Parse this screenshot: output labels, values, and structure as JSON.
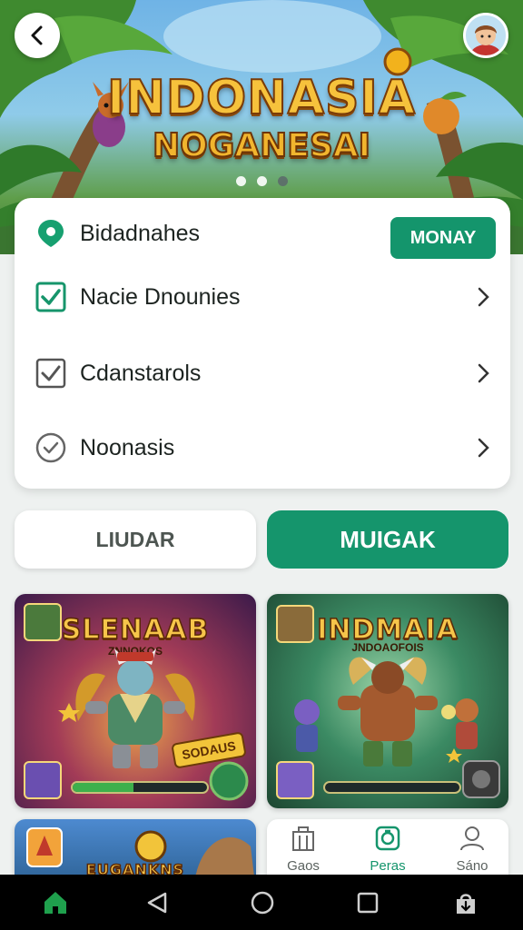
{
  "banner": {
    "title_line1": "INDONASIA",
    "title_line2": "NOGANESAI",
    "carousel_pages": 3,
    "carousel_active": 2
  },
  "settings": {
    "items": [
      {
        "label": "Bidadnahes",
        "icon": "location-pin-icon",
        "action_label": "MONAY"
      },
      {
        "label": "Nacie Dnounies",
        "icon": "checkbox-checked-icon"
      },
      {
        "label": "Cdanstarols",
        "icon": "checkbox-icon"
      },
      {
        "label": "Noonasis",
        "icon": "check-circle-icon"
      }
    ]
  },
  "actions": {
    "secondary_label": "LIUDAR",
    "primary_label": "MUIGAK"
  },
  "games": [
    {
      "title": "SLENAAB",
      "subtitle": "ZNNOKOS",
      "sticker": "SODAUS",
      "progress": 0.45
    },
    {
      "title": "INDMAIA",
      "subtitle": "JNDOAOFOIS",
      "progress": 0.0
    },
    {
      "title": "EUGANKNS"
    }
  ],
  "quick_nav": [
    {
      "label": "Gaos",
      "icon": "building-icon"
    },
    {
      "label": "Peras",
      "icon": "badge-icon",
      "active": true
    },
    {
      "label": "Sáno",
      "icon": "person-icon"
    }
  ],
  "colors": {
    "accent": "#15956c",
    "title_gold": "#f6c23c"
  }
}
